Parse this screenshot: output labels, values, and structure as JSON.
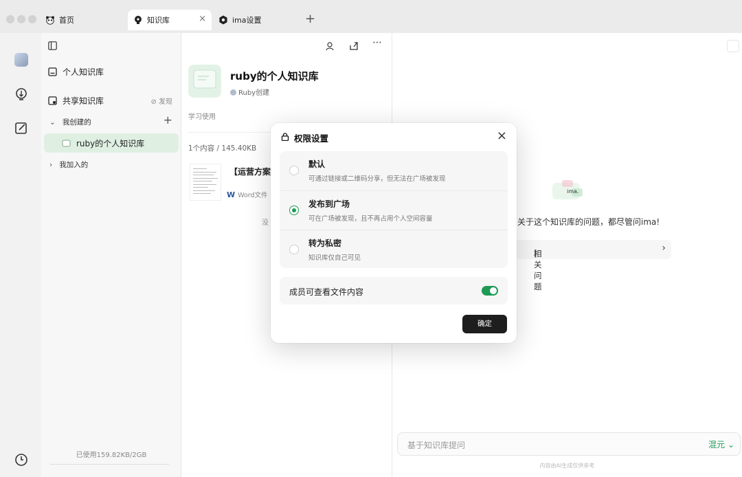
{
  "tabs": [
    {
      "label": "首页",
      "icon": "panda-icon"
    },
    {
      "label": "知识库",
      "icon": "bulb-icon",
      "active": true
    },
    {
      "label": "ima设置",
      "icon": "settings-icon"
    }
  ],
  "tab_close": "×",
  "tab_add": "+",
  "sidebar": {
    "personal_kb": "个人知识库",
    "shared_kb": "共享知识库",
    "discover": "⊘ 发现",
    "created_by_me": "我创建的",
    "add": "+",
    "active_kb": "ruby的个人知识库",
    "joined": "我加入的",
    "storage": "已使用159.82KB/2GB"
  },
  "kb": {
    "title": "ruby的个人知识库",
    "creator": "Ruby创建",
    "description": "学习使用",
    "count": "1个内容 / 145.40KB",
    "doc_title": "【运营方案】",
    "doc_type_icon": "W",
    "doc_type": "Word文件",
    "doc_tail": "没"
  },
  "right": {
    "ask_text": "关于这个知识库的问题，都尽管问ima!",
    "related": "相关问题",
    "related_prefix": "|",
    "chevron": "›",
    "input_placeholder": "基于知识库提问",
    "model": "混元 ⌄",
    "footnote": "内容由AI生成仅供参考",
    "logo_text": "ima."
  },
  "modal": {
    "title": "权限设置",
    "close": "×",
    "options": [
      {
        "label": "默认",
        "desc": "可通过链接或二维码分享，但无法在广场被发现",
        "selected": false
      },
      {
        "label": "发布到广场",
        "desc": "可在广场被发现，且不再占用个人空间容量",
        "selected": true
      },
      {
        "label": "转为私密",
        "desc": "知识库仅自己可见",
        "selected": false
      }
    ],
    "member_view": "成员可查看文件内容",
    "member_view_on": true,
    "confirm": "确定"
  },
  "colors": {
    "accent": "#1f9a55",
    "active_bg": "#dff0e3",
    "confirm_bg": "#1e1e1e"
  }
}
